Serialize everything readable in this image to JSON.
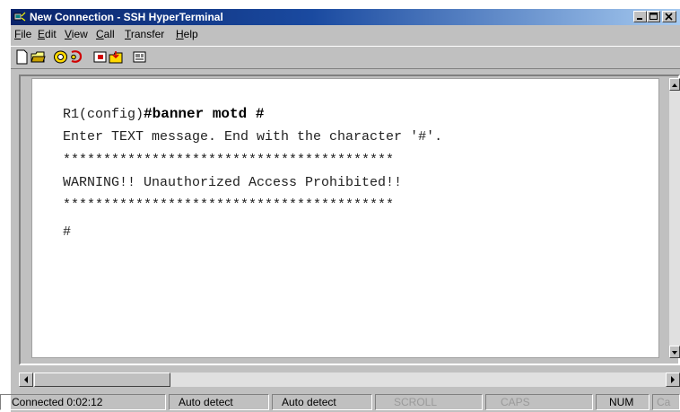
{
  "window": {
    "title": "New Connection - SSH HyperTerminal",
    "title_bar_color": "#0a246a"
  },
  "menu": [
    {
      "underline": "F",
      "rest": "ile"
    },
    {
      "underline": "E",
      "rest": "dit"
    },
    {
      "underline": "V",
      "rest": "iew"
    },
    {
      "underline": "C",
      "rest": "all"
    },
    {
      "underline": "T",
      "rest": "ransfer"
    },
    {
      "underline": "H",
      "rest": "elp"
    }
  ],
  "toolbar": {
    "icons": [
      "new-document-icon",
      "open-folder-icon",
      "call-icon",
      "disconnect-icon",
      "send-file-icon",
      "receive-file-icon",
      "properties-icon"
    ]
  },
  "terminal": {
    "prompt": "R1(config)",
    "command": "#banner motd #",
    "lines": [
      "Enter TEXT message. End with the character '#'.",
      "*****************************************",
      "WARNING!! Unauthorized Access Prohibited!!",
      "*****************************************",
      "#"
    ]
  },
  "status": {
    "connected": "Connected 0:02:12",
    "terminal_detect": "Auto detect",
    "baud_detect": "Auto detect",
    "scroll": "SCROLL",
    "caps": "CAPS",
    "num": "NUM",
    "capture": "Ca"
  }
}
